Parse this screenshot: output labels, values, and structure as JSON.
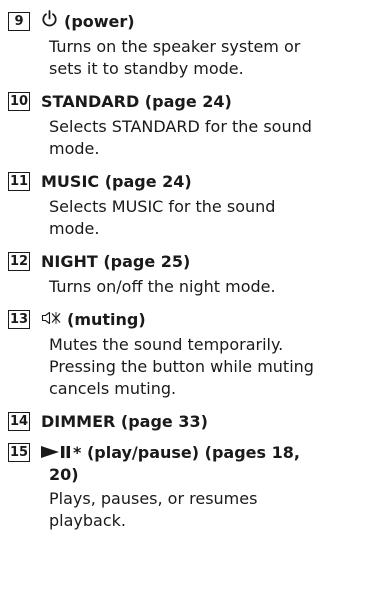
{
  "items": [
    {
      "number": "9",
      "symbol_icon": "power-icon",
      "title": "(power)",
      "lines": [
        "Turns on the speaker system or",
        "sets it to standby mode."
      ]
    },
    {
      "number": "10",
      "title": "STANDARD (page 24)",
      "lines": [
        "Selects STANDARD for the sound",
        "mode."
      ]
    },
    {
      "number": "11",
      "title": "MUSIC (page 24)",
      "lines": [
        "Selects MUSIC for the sound",
        "mode."
      ]
    },
    {
      "number": "12",
      "title": "NIGHT (page 25)",
      "lines": [
        "Turns on/off the night mode."
      ]
    },
    {
      "number": "13",
      "symbol_icon": "muting-icon",
      "title": "(muting)",
      "lines": [
        "Mutes the sound temporarily.",
        "Pressing the button while muting",
        "cancels muting."
      ]
    },
    {
      "number": "14",
      "title": "DIMMER (page 33)",
      "lines": []
    },
    {
      "number": "15",
      "symbol_icon": "play-pause-icon",
      "title_lines": [
        "* (play/pause) (pages 18,",
        "20)"
      ],
      "lines": [
        "Plays, pauses, or resumes",
        "playback."
      ]
    }
  ]
}
